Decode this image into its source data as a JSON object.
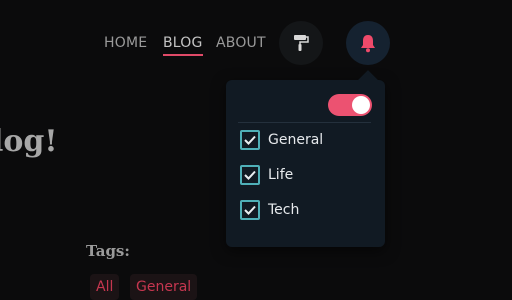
{
  "nav": {
    "home": "HOME",
    "blog": "BLOG",
    "about": "ABOUT",
    "brush_icon": "paint-roller-icon",
    "bell_icon": "bell-icon"
  },
  "hero": {
    "partial_title": "log!"
  },
  "tags": {
    "label": "Tags:",
    "items": [
      "All",
      "General"
    ]
  },
  "panel": {
    "toggle_on": true,
    "toggle_color": "#ec5271",
    "categories": [
      {
        "label": "General",
        "checked": true
      },
      {
        "label": "Life",
        "checked": true
      },
      {
        "label": "Tech",
        "checked": true
      }
    ]
  }
}
